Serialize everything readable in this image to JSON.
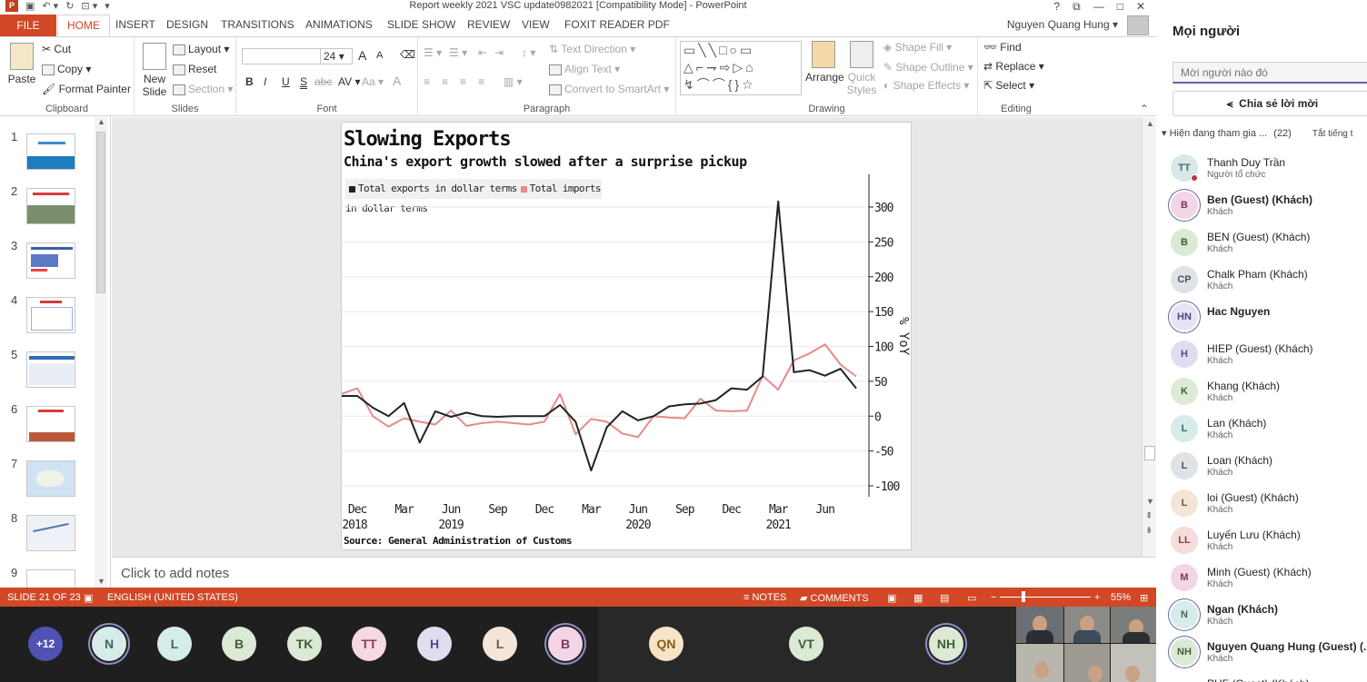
{
  "window": {
    "title": "Report weekly 2021 VSC update0982021 [Compatibility Mode] - PowerPoint",
    "user_name": "Nguyen Quang Hung",
    "help_glyph": "?",
    "restore_glyph": "⧉",
    "minimize_glyph": "—",
    "maximize_glyph": "□",
    "close_glyph": "✕"
  },
  "ribbon_tabs": [
    "FILE",
    "HOME",
    "INSERT",
    "DESIGN",
    "TRANSITIONS",
    "ANIMATIONS",
    "SLIDE SHOW",
    "REVIEW",
    "VIEW",
    "FOXIT READER PDF"
  ],
  "ribbon": {
    "clipboard": {
      "paste": "Paste",
      "cut": "Cut",
      "copy": "Copy",
      "format_painter": "Format Painter",
      "label": "Clipboard"
    },
    "slides": {
      "new_slide": "New Slide",
      "layout": "Layout",
      "reset": "Reset",
      "section": "Section",
      "label": "Slides"
    },
    "font": {
      "size": "24",
      "bold": "B",
      "italic": "I",
      "underline": "U",
      "strike": "S",
      "shadow": "abc",
      "spacing": "AV",
      "case": "Aa",
      "color": "A",
      "grow": "A",
      "shrink": "A",
      "label": "Font"
    },
    "paragraph": {
      "text_direction": "Text Direction",
      "align_text": "Align Text",
      "convert_smartart": "Convert to SmartArt",
      "label": "Paragraph"
    },
    "drawing": {
      "arrange": "Arrange",
      "quick_styles": "Quick Styles",
      "shape_fill": "Shape Fill",
      "shape_outline": "Shape Outline",
      "shape_effects": "Shape Effects",
      "label": "Drawing"
    },
    "editing": {
      "find": "Find",
      "replace": "Replace",
      "select": "Select",
      "label": "Editing"
    }
  },
  "thumbnails": [
    "1",
    "2",
    "3",
    "4",
    "5",
    "6",
    "7",
    "8",
    "9"
  ],
  "slide": {
    "title": "Slowing Exports",
    "subtitle": "China's export growth slowed after a surprise pickup",
    "legend_exports": "Total exports in dollar terms",
    "legend_imports": "Total imports in dollar terms",
    "source": "Source: General Administration of Customs"
  },
  "chart_data": {
    "type": "line",
    "ylabel": "% YoY",
    "ylim": [
      -100,
      300
    ],
    "yticks": [
      300,
      250,
      200,
      150,
      100,
      50,
      0,
      -50,
      -100
    ],
    "x_month_ticks": [
      {
        "label": "Dec",
        "index": 1
      },
      {
        "label": "Mar",
        "index": 4
      },
      {
        "label": "Jun",
        "index": 7
      },
      {
        "label": "Sep",
        "index": 10
      },
      {
        "label": "Dec",
        "index": 13
      },
      {
        "label": "Mar",
        "index": 16
      },
      {
        "label": "Jun",
        "index": 19
      },
      {
        "label": "Sep",
        "index": 22
      },
      {
        "label": "Dec",
        "index": 25
      },
      {
        "label": "Mar",
        "index": 28
      },
      {
        "label": "Jun",
        "index": 31
      }
    ],
    "x_year_ticks": [
      {
        "label": "2018",
        "index": 0
      },
      {
        "label": "2019",
        "index": 7
      },
      {
        "label": "2020",
        "index": 19
      },
      {
        "label": "2021",
        "index": 28
      }
    ],
    "series": [
      {
        "name": "Total exports in dollar terms",
        "color": "#222222",
        "values": [
          29,
          29,
          12,
          0,
          19,
          -38,
          7,
          -1,
          5,
          0,
          -1,
          0,
          0,
          0,
          16,
          -8,
          -78,
          -16,
          7,
          -6,
          0,
          14,
          17,
          18,
          23,
          40,
          38,
          57,
          308,
          63,
          66,
          58,
          68,
          40
        ]
      },
      {
        "name": "Total imports in dollar terms",
        "color": "#e58a8a",
        "values": [
          32,
          40,
          0,
          -15,
          -3,
          -8,
          -12,
          8,
          -14,
          -10,
          -8,
          -10,
          -12,
          -8,
          32,
          -26,
          -4,
          -8,
          -25,
          -30,
          0,
          -2,
          -3,
          25,
          8,
          7,
          8,
          58,
          38,
          80,
          90,
          103,
          74,
          57
        ]
      }
    ]
  },
  "notes_placeholder": "Click to add notes",
  "statusbar": {
    "slide_info": "SLIDE 21 OF 23",
    "language": "ENGLISH (UNITED STATES)",
    "notes": "NOTES",
    "comments": "COMMENTS",
    "zoom": "55%"
  },
  "panel": {
    "title": "Mọi người",
    "invite_placeholder": "Mời người nào đó",
    "share_label": "Chia sẻ lời mời",
    "section_label": "Hiện đang tham gia ...",
    "section_count": "(22)",
    "mute_all": "Tắt tiếng t",
    "people": [
      {
        "initials": "TT",
        "name": "Thanh Duy Trần",
        "role": "Người tổ chức",
        "bold": false,
        "bg": "#d6e9e8",
        "fg": "#4a6a68",
        "ring": false
      },
      {
        "initials": "B",
        "name": "Ben (Guest) (Khách)",
        "role": "Khách",
        "bold": true,
        "bg": "#f3d5e6",
        "fg": "#7a3a5c",
        "ring": true
      },
      {
        "initials": "B",
        "name": "BEN (Guest) (Khách)",
        "role": "Khách",
        "bold": false,
        "bg": "#dce9d5",
        "fg": "#3f5e35",
        "ring": false
      },
      {
        "initials": "CP",
        "name": "Chalk Pham (Khách)",
        "role": "Khách",
        "bold": false,
        "bg": "#dfe3e6",
        "fg": "#4a545c",
        "ring": false
      },
      {
        "initials": "HN",
        "name": "Hac Nguyen",
        "role": "",
        "bold": true,
        "bg": "#e7e4f3",
        "fg": "#4b4780",
        "ring": true
      },
      {
        "initials": "H",
        "name": "HIEP (Guest) (Khách)",
        "role": "Khách",
        "bold": false,
        "bg": "#e1ddf1",
        "fg": "#514a86",
        "ring": false
      },
      {
        "initials": "K",
        "name": "Khang (Khách)",
        "role": "Khách",
        "bold": false,
        "bg": "#dcecd4",
        "fg": "#3c5e2f",
        "ring": false
      },
      {
        "initials": "L",
        "name": "Lan (Khách)",
        "role": "Khách",
        "bold": false,
        "bg": "#d5ece9",
        "fg": "#3f6560",
        "ring": false
      },
      {
        "initials": "L",
        "name": "Loan (Khách)",
        "role": "Khách",
        "bold": false,
        "bg": "#dfe3e6",
        "fg": "#4a545c",
        "ring": false
      },
      {
        "initials": "L",
        "name": "loi (Guest) (Khách)",
        "role": "Khách",
        "bold": false,
        "bg": "#f3e5d8",
        "fg": "#7a5537",
        "ring": false
      },
      {
        "initials": "LL",
        "name": "Luyến Lưu (Khách)",
        "role": "Khách",
        "bold": false,
        "bg": "#f6dcdc",
        "fg": "#8a3f3f",
        "ring": false
      },
      {
        "initials": "M",
        "name": "Minh (Guest) (Khách)",
        "role": "Khách",
        "bold": false,
        "bg": "#f3d5e6",
        "fg": "#7a3a5c",
        "ring": false
      },
      {
        "initials": "N",
        "name": "Ngan (Khách)",
        "role": "Khách",
        "bold": true,
        "bg": "#d5ece9",
        "fg": "#3f6560",
        "ring": true
      },
      {
        "initials": "NH",
        "name": "Nguyen Quang Hung (Guest) (...",
        "role": "Khách",
        "bold": true,
        "bg": "#dce9d5",
        "fg": "#3f5e35",
        "ring": true
      },
      {
        "initials": "",
        "name": "PHF (Guest) (Khách)",
        "role": "",
        "bold": false,
        "bg": "#ffffff",
        "fg": "#424242",
        "ring": false
      }
    ]
  },
  "meeting_strip": {
    "avatars": [
      {
        "label": "+12",
        "bg": "#4f52b2",
        "fg": "#ffffff",
        "ring": false
      },
      {
        "label": "N",
        "bg": "#d5ece9",
        "fg": "#3f6560",
        "ring": true
      },
      {
        "label": "L",
        "bg": "#d5ece9",
        "fg": "#3f6560",
        "ring": false
      },
      {
        "label": "B",
        "bg": "#dce9d5",
        "fg": "#3f5e35",
        "ring": false
      },
      {
        "label": "TK",
        "bg": "#dce9d5",
        "fg": "#3f5e35",
        "ring": false
      },
      {
        "label": "TT",
        "bg": "#f6d8e4",
        "fg": "#8a3f5c",
        "ring": false
      },
      {
        "label": "H",
        "bg": "#e1ddf1",
        "fg": "#514a86",
        "ring": false
      },
      {
        "label": "L",
        "bg": "#f3e5d8",
        "fg": "#7a5537",
        "ring": false
      },
      {
        "label": "B",
        "bg": "#f3d5e6",
        "fg": "#7a3a5c",
        "ring": true
      }
    ],
    "center_avatars": [
      {
        "label": "QN",
        "bg": "#f7e3c6",
        "fg": "#8a5a1a",
        "ring": false
      },
      {
        "label": "VT",
        "bg": "#dce9d5",
        "fg": "#3f5e35",
        "ring": false
      },
      {
        "label": "NH",
        "bg": "#dce9d5",
        "fg": "#3f5e35",
        "ring": true
      }
    ]
  }
}
